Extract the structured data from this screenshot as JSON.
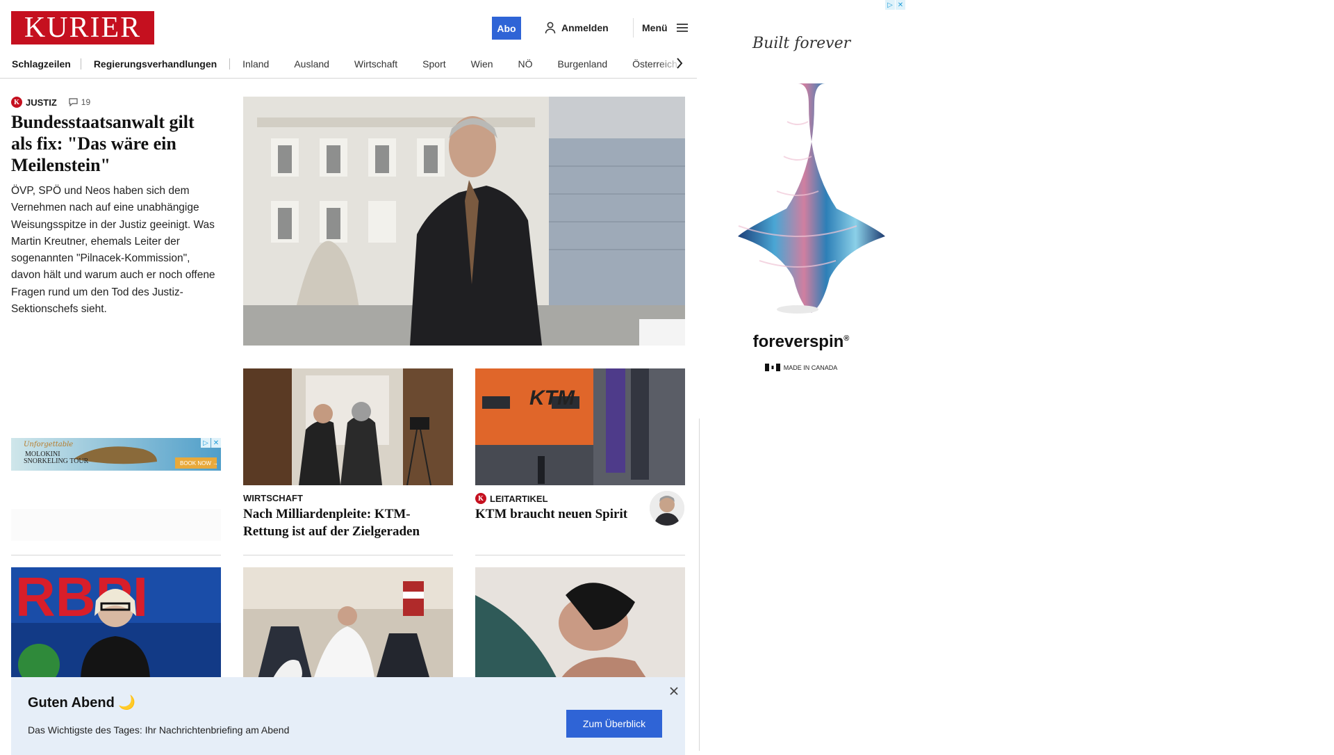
{
  "header": {
    "logo_text": "KURIER",
    "abo_label": "Abo",
    "login_label": "Anmelden",
    "menu_label": "Menü"
  },
  "nav": {
    "items": [
      "Schlagzeilen",
      "Regierungsverhandlungen",
      "Inland",
      "Ausland",
      "Wirtschaft",
      "Sport",
      "Wien",
      "NÖ",
      "Burgenland",
      "Österreich"
    ]
  },
  "lead": {
    "kicker": "JUSTIZ",
    "comment_count": "19",
    "title": "Bundesstaatsanwalt gilt als fix: \"Das wäre ein Meilenstein\"",
    "teaser": "ÖVP, SPÖ und Neos haben sich dem Vernehmen nach auf eine unabhängige Weisungsspitze in der Justiz geeinigt. Was Martin Kreutner, ehemals Leiter der sogenannten \"Pilnacek-Kommission\", davon hält und warum auch er noch offene Fragen rund um den Tod des Justiz-Sektionschefs sieht."
  },
  "cards": [
    {
      "kicker": "WIRTSCHAFT",
      "title": "Nach Milliardenpleite: KTM-Rettung ist auf der Zielgeraden"
    },
    {
      "kicker": "LEITARTIKEL",
      "title": "KTM braucht neuen Spirit"
    }
  ],
  "small_ad": {
    "line1": "Unforgettable",
    "line2": "MOLOKINI",
    "line3": "SNORKELING TOUR",
    "cta": "BOOK NOW →"
  },
  "right_ad": {
    "tagline": "Built forever",
    "brand": "foreverspin",
    "registered": "®",
    "origin": "MADE IN CANADA"
  },
  "banner": {
    "title": "Guten Abend 🌙",
    "subtitle": "Das Wichtigste des Tages: Ihr Nachrichtenbriefing am Abend",
    "button_label": "Zum Überblick"
  },
  "colors": {
    "brand_red": "#c5101f",
    "accent_blue": "#2f64d6",
    "banner_bg": "#e6eef8"
  }
}
